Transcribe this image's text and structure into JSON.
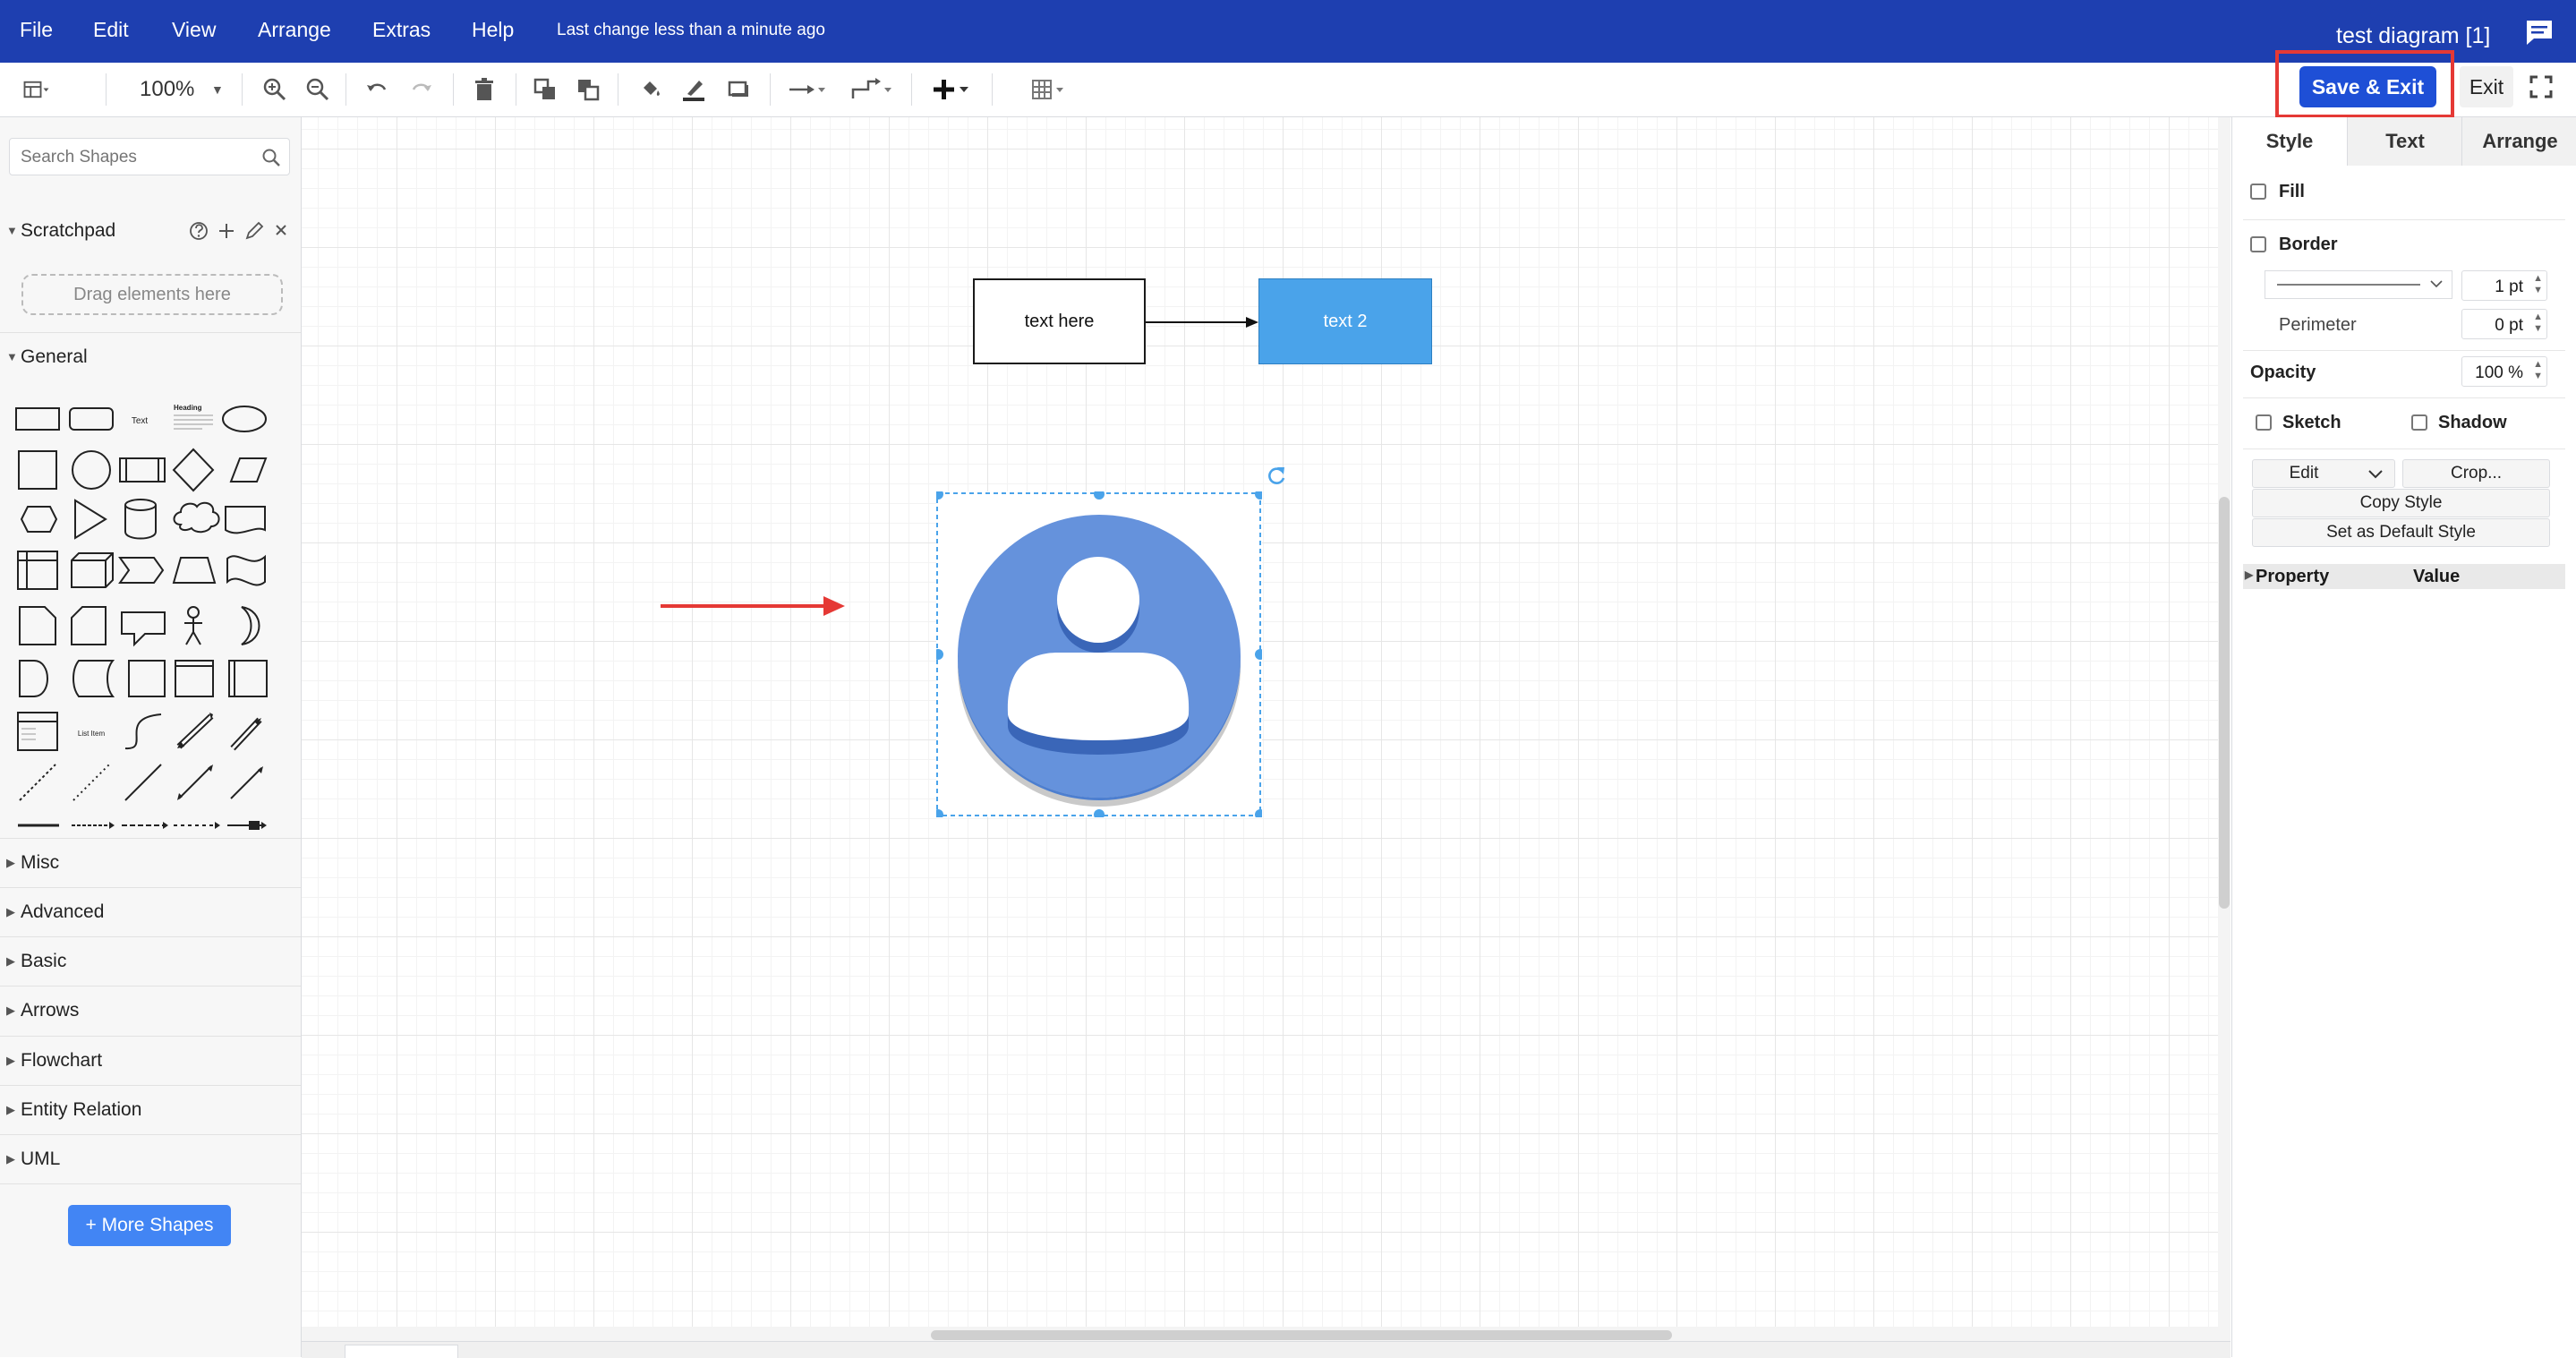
{
  "menubar": {
    "items": [
      "File",
      "Edit",
      "View",
      "Arrange",
      "Extras",
      "Help"
    ],
    "status": "Last change less than a minute ago",
    "title": "test diagram [1]"
  },
  "toolbar": {
    "zoom": "100%",
    "save_exit_label": "Save & Exit",
    "exit_label": "Exit"
  },
  "sidebar": {
    "search_placeholder": "Search Shapes",
    "scratchpad_label": "Scratchpad",
    "drag_hint": "Drag elements here",
    "general_label": "General",
    "sections": [
      "Misc",
      "Advanced",
      "Basic",
      "Arrows",
      "Flowchart",
      "Entity Relation",
      "UML"
    ],
    "more_shapes_label": "+ More Shapes",
    "shape_labels": {
      "text": "Text",
      "heading": "Heading",
      "list_item": "List Item"
    }
  },
  "canvas": {
    "node1_text": "text here",
    "node2_text": "text 2",
    "node2_color": "#4aa3ea",
    "selection_color": "#4aa3ea",
    "user_icon_color": "#6592dc"
  },
  "format_panel": {
    "tabs": [
      "Style",
      "Text",
      "Arrange"
    ],
    "fill_label": "Fill",
    "border_label": "Border",
    "border_width": "1 pt",
    "perimeter_label": "Perimeter",
    "perimeter_value": "0 pt",
    "opacity_label": "Opacity",
    "opacity_value": "100 %",
    "sketch_label": "Sketch",
    "shadow_label": "Shadow",
    "edit_label": "Edit",
    "crop_label": "Crop...",
    "copy_style_label": "Copy Style",
    "set_default_label": "Set as Default Style",
    "property_header": "Property",
    "value_header": "Value"
  },
  "colors": {
    "menubar": "#1e3fb0",
    "save_button": "#1e4fd6",
    "highlight": "#e53935",
    "annotation_arrow": "#e53935"
  }
}
